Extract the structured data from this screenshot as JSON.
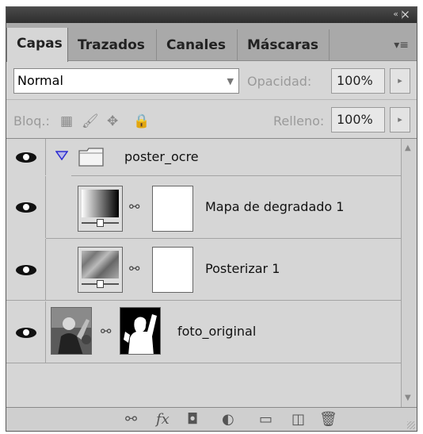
{
  "tabs": [
    "Capas",
    "Trazados",
    "Canales",
    "Máscaras"
  ],
  "blend": {
    "mode": "Normal",
    "opacity_label": "Opacidad:",
    "opacity_value": "100%"
  },
  "lock": {
    "label": "Bloq.:",
    "fill_label": "Relleno:",
    "fill_value": "100%"
  },
  "layers": [
    {
      "name": "poster_ocre"
    },
    {
      "name": "Mapa de degradado 1"
    },
    {
      "name": "Posterizar 1"
    },
    {
      "name": "foto_original"
    }
  ],
  "icons": {
    "collapse": "«",
    "close": "×",
    "panel_menu": "▾≡",
    "dropdown": "▼",
    "flyout": "▸",
    "lock_transparent": "▦",
    "lock_paint": "🖌",
    "lock_move": "✥",
    "lock_all": "🔒",
    "link_layers": "⚯",
    "fx": "fx",
    "add_mask": "◘",
    "adjustment": "◐",
    "new_group": "▭",
    "new_layer": "◫",
    "trash": "🗑"
  }
}
